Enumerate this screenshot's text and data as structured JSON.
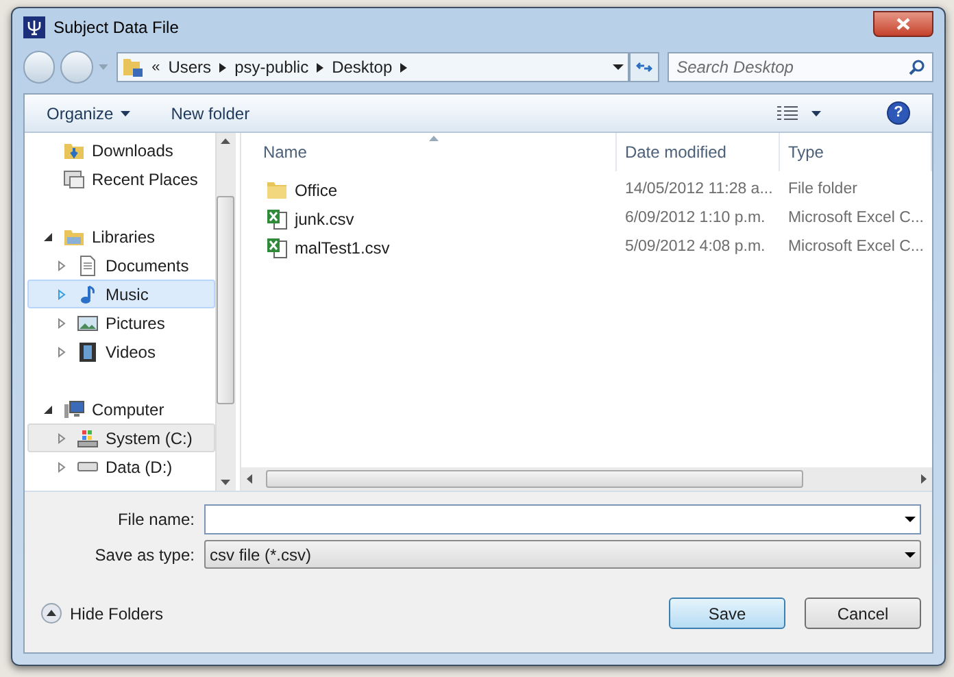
{
  "window": {
    "title": "Subject Data File"
  },
  "address_bar": {
    "overflow": "«",
    "segments": [
      "Users",
      "psy-public",
      "Desktop"
    ]
  },
  "search": {
    "placeholder": "Search Desktop"
  },
  "toolbar": {
    "organize": "Organize",
    "new_folder": "New folder",
    "help": "?"
  },
  "sidebar": {
    "items": [
      {
        "label": "Downloads",
        "kind": "downloads",
        "selected": false,
        "hovered": false
      },
      {
        "label": "Recent Places",
        "kind": "recent",
        "selected": false,
        "hovered": false
      },
      {
        "label": "Libraries",
        "kind": "libraries",
        "expanded": true,
        "selected": false,
        "hovered": false,
        "children": [
          {
            "label": "Documents",
            "kind": "documents",
            "expanded": false,
            "selected": false,
            "hovered": false
          },
          {
            "label": "Music",
            "kind": "music",
            "expanded": false,
            "selected": true,
            "hovered": false
          },
          {
            "label": "Pictures",
            "kind": "pictures",
            "expanded": false,
            "selected": false,
            "hovered": false
          },
          {
            "label": "Videos",
            "kind": "videos",
            "expanded": false,
            "selected": false,
            "hovered": false
          }
        ]
      },
      {
        "label": "Computer",
        "kind": "computer",
        "expanded": true,
        "selected": false,
        "hovered": false,
        "children": [
          {
            "label": "System (C:)",
            "kind": "system_drive",
            "expanded": false,
            "selected": false,
            "hovered": true
          },
          {
            "label": "Data (D:)",
            "kind": "drive",
            "expanded": false,
            "selected": false,
            "hovered": false
          }
        ]
      }
    ]
  },
  "file_list": {
    "columns": [
      "Name",
      "Date modified",
      "Type"
    ],
    "rows": [
      {
        "kind": "folder",
        "name": "Office",
        "date": "14/05/2012 11:28 a...",
        "type": "File folder"
      },
      {
        "kind": "csv",
        "name": "junk.csv",
        "date": "6/09/2012 1:10 p.m.",
        "type": "Microsoft Excel C..."
      },
      {
        "kind": "csv",
        "name": "malTest1.csv",
        "date": "5/09/2012 4:08 p.m.",
        "type": "Microsoft Excel C..."
      }
    ]
  },
  "form": {
    "file_name_label": "File name:",
    "save_type_label": "Save as type:",
    "save_type_value": "csv file (*.csv)"
  },
  "footer": {
    "hide_folders": "Hide Folders",
    "save": "Save",
    "cancel": "Cancel"
  }
}
